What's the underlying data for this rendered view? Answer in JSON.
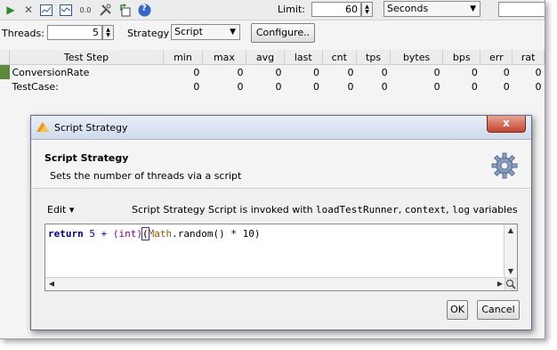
{
  "toolbar": {
    "icons": [
      "run-icon",
      "cancel-icon",
      "chart-icon",
      "graph-icon",
      "reset-icon",
      "tools-icon",
      "export-icon",
      "help-icon"
    ],
    "run_glyph": "▶",
    "cancel_glyph": "✕",
    "reset_text": "0.0",
    "help_glyph": "?",
    "limit_label": "Limit:",
    "limit_value": "60",
    "limit_unit": "Seconds"
  },
  "threads_row": {
    "threads_label": "Threads:",
    "threads_value": "5",
    "strategy_label": "Strategy",
    "strategy_value": "Script",
    "configure_label": "Configure.."
  },
  "table": {
    "columns": [
      "Test Step",
      "min",
      "max",
      "avg",
      "last",
      "cnt",
      "tps",
      "bytes",
      "bps",
      "err",
      "rat"
    ],
    "rows": [
      {
        "name": "ConversionRate",
        "values": [
          "0",
          "0",
          "0",
          "0",
          "0",
          "0",
          "0",
          "0",
          "0",
          "0"
        ]
      },
      {
        "name": "TestCase:",
        "values": [
          "0",
          "0",
          "0",
          "0",
          "0",
          "0",
          "0",
          "0",
          "0",
          "0"
        ]
      }
    ]
  },
  "dialog": {
    "title": "Script Strategy",
    "close_glyph": "x",
    "header_title": "Script Strategy",
    "header_desc": "Sets the number of threads via a script",
    "edit_label": "Edit",
    "edit_arrow": "▾",
    "info_text": "Script Strategy Script is invoked with ",
    "var1": "loadTestRunner",
    "sep1": ", ",
    "var2": "context",
    "sep2": ", ",
    "var3": "log",
    "info_tail": " variables",
    "code": {
      "kw": "return",
      "n1": " 5 ",
      "op1": "+ ",
      "cast": "(int)",
      "paren": "(",
      "cls": "Math",
      "rest": ".random() * 10)"
    },
    "ok_label": "OK",
    "cancel_label": "Cancel"
  }
}
